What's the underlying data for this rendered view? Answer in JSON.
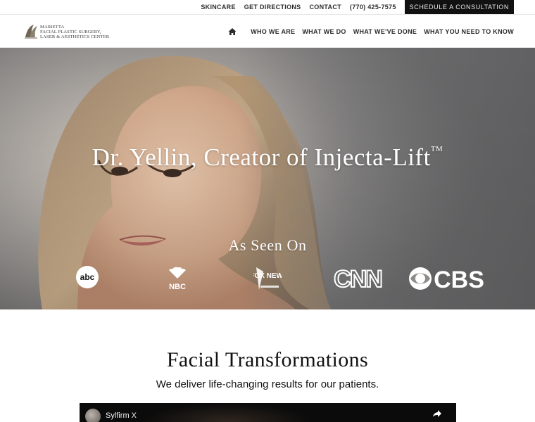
{
  "topbar": {
    "links": [
      "SKINCARE",
      "GET DIRECTIONS",
      "CONTACT",
      "(770) 425-7575"
    ],
    "consult_label": "SCHEDULE A CONSULTATION"
  },
  "logo": {
    "line1": "MARIETTA",
    "line2": "FACIAL PLASTIC SURGERY,",
    "line3": "LASER & AESTHETICS CENTER"
  },
  "nav": {
    "home_icon": "home-icon",
    "items": [
      "WHO WE ARE",
      "WHAT WE DO",
      "WHAT WE'VE DONE",
      "WHAT YOU NEED TO KNOW"
    ]
  },
  "hero": {
    "title": "Dr. Yellin, Creator of Injecta-Lift",
    "trademark": "TM",
    "seen_on": "As Seen On",
    "media_logos": [
      "abc",
      "NBC",
      "FOX NEWS",
      "CNN",
      "CBS"
    ]
  },
  "section": {
    "title": "Facial Transformations",
    "subtitle": "We deliver life-changing results for our patients."
  },
  "video": {
    "title": "Sylfirm X",
    "share_icon": "share-icon"
  },
  "colors": {
    "consult_bg": "#111111",
    "hero_text": "#ffffff"
  }
}
